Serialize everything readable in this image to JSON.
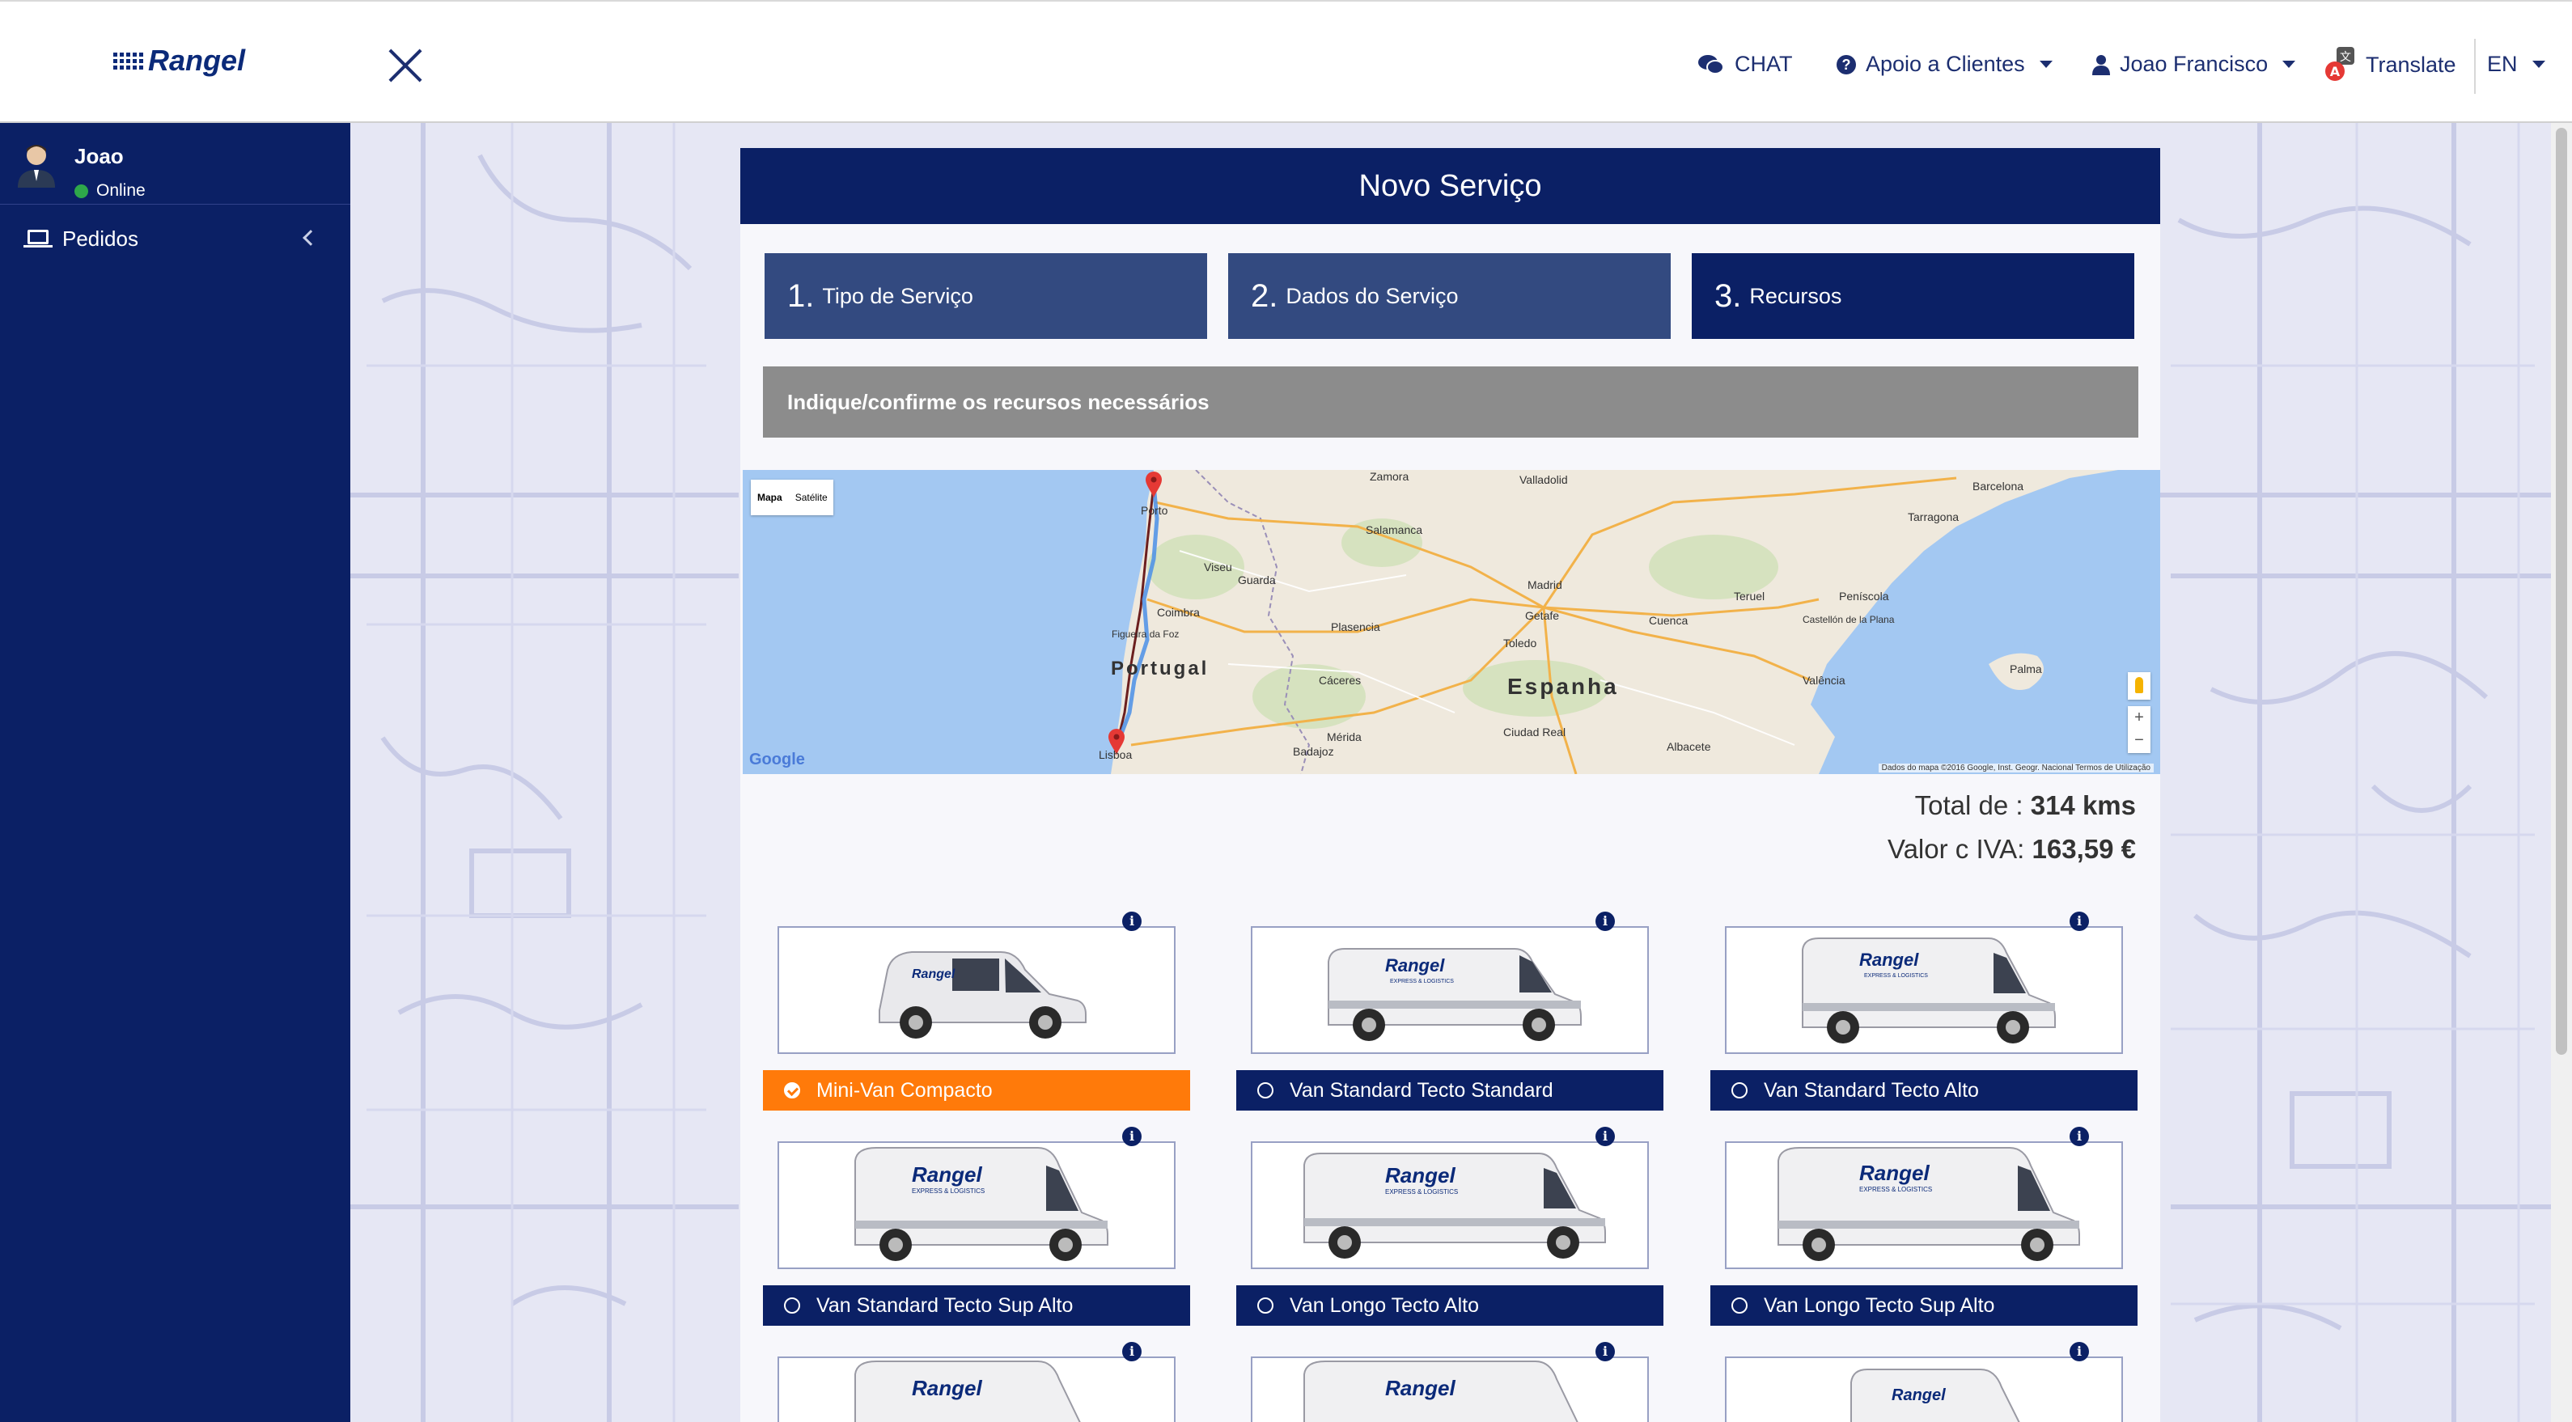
{
  "brand": {
    "logo_text": "Rangel"
  },
  "topnav": {
    "chat": "CHAT",
    "support": "Apoio a Clientes",
    "user": "Joao Francisco",
    "translate": "Translate",
    "language": "EN"
  },
  "sidebar": {
    "user_name": "Joao",
    "user_status": "Online",
    "items": [
      {
        "label": "Pedidos",
        "icon": "laptop-icon"
      }
    ]
  },
  "page": {
    "title": "Novo Serviço",
    "steps": [
      {
        "num": "1.",
        "label": "Tipo de Serviço"
      },
      {
        "num": "2.",
        "label": "Dados do Serviço"
      },
      {
        "num": "3.",
        "label": "Recursos"
      }
    ],
    "instruction": "Indique/confirme os recursos necessários"
  },
  "map": {
    "type_options": [
      "Mapa",
      "Satélite"
    ],
    "labels": [
      "Porto",
      "Lisboa",
      "Portugal",
      "Espanha",
      "Madrid",
      "Barcelona",
      "Zamora",
      "Salamanca",
      "Valladolid",
      "Viseu",
      "Guarda",
      "Coimbra",
      "Plasencia",
      "Cáceres",
      "Mérida",
      "Badajoz",
      "Toledo",
      "Getafe",
      "Cuenca",
      "Ciudad Real",
      "Albacete",
      "Valência",
      "Teruel",
      "Tarragona",
      "Castellón de la Plana",
      "Palma",
      "Peníscola",
      "Figueira da Foz"
    ],
    "google": "Google",
    "attribution": "Dados do mapa ©2016 Google, Inst. Geogr. Nacional   Termos de Utilização",
    "zoom_in": "+",
    "zoom_out": "−"
  },
  "summary": {
    "total_label": "Total de :",
    "total_value": "314 kms",
    "price_label": "Valor c IVA:",
    "price_value": "163,59 €"
  },
  "vehicles": [
    {
      "label": "Mini-Van Compacto",
      "selected": true
    },
    {
      "label": "Van Standard Tecto Standard",
      "selected": false
    },
    {
      "label": "Van Standard Tecto Alto",
      "selected": false
    },
    {
      "label": "Van Standard Tecto Sup Alto",
      "selected": false
    },
    {
      "label": "Van Longo Tecto Alto",
      "selected": false
    },
    {
      "label": "Van Longo Tecto Sup Alto",
      "selected": false
    }
  ],
  "colors": {
    "navy": "#0b2065",
    "step_inactive": "#334a80",
    "selected_orange": "#ff7a0a",
    "banner_gray": "#8c8c8c"
  }
}
